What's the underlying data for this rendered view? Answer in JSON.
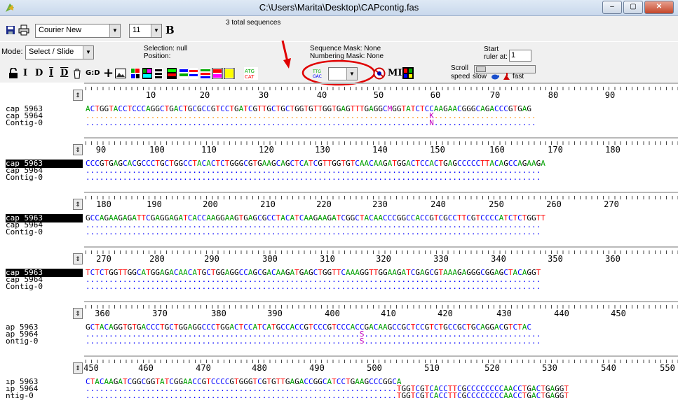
{
  "window": {
    "title": "C:\\Users\\Marita\\Desktop\\CAPcontig.fas",
    "minimize": "–",
    "maximize": "▢",
    "close": "✕"
  },
  "toolbar": {
    "font": "Courier New",
    "size": "11",
    "bold": "B",
    "total": "3 total sequences"
  },
  "mode": {
    "label": "Mode:",
    "value": "Select / Slide"
  },
  "selection": {
    "line1": "Selection: null",
    "line2": "Position:"
  },
  "masks": {
    "sequence": "Sequence Mask: None",
    "numbering": "Numbering Mask: None"
  },
  "start_ruler": {
    "label1": "Start",
    "label2": "ruler at:",
    "value": "1"
  },
  "scroll": {
    "label1": "Scroll",
    "label2": "speed",
    "slow": "slow",
    "fast": "fast"
  },
  "icons": [
    "I",
    "D",
    "I",
    "D",
    "G:D",
    "MI"
  ],
  "colors": {
    "A": "#00a000",
    "C": "#0000ff",
    "G": "#000000",
    "T": "#ff0000",
    "dot": "#ff8c00",
    "highlight": "#ff0000"
  },
  "blocks": [
    {
      "ruler": [
        "10",
        "20",
        "30",
        "40",
        "50",
        "60",
        "70",
        "80",
        "90"
      ],
      "names": [
        "cap 5963",
        "cap 5964",
        "Contig-0"
      ],
      "selected": -1,
      "rows": [
        "ACTGGTACCTCCCAGGCTGACTGCGCCGTCCTGATCGTTGCTGCTGGTGTTGGTGAGTTTGAGGCMGGTATCTCCAAGAACGGGCAGACCCGTGAG",
        "..........................................................................K......................",
        "..........................................................................N......................"
      ],
      "dot_colors": [
        "#ff8c00",
        "#0000ff"
      ]
    },
    {
      "ruler": [
        "90",
        "100",
        "110",
        "120",
        "130",
        "140",
        "150",
        "160",
        "170",
        "180"
      ],
      "names": [
        "cap 5963",
        "cap 5964",
        "Contig-0"
      ],
      "selected": 0,
      "rows": [
        "CCCGTGAGCACGCCCTGCTGGCCTACACTCTGGGCGTGAAGCAGCTCATCGTTGGTGTCAACAAGATGGACTCCACTGAGCCCCCTTACAGCCAGAAGA",
        "..................................................................................................",
        ".................................................................................................."
      ],
      "dot_colors": [
        "#0000ff",
        "#0000ff"
      ]
    },
    {
      "ruler": [
        "180",
        "190",
        "200",
        "210",
        "220",
        "230",
        "240",
        "250",
        "260",
        "270"
      ],
      "names": [
        "cap 5963",
        "cap 5964",
        "Contig-0"
      ],
      "selected": 0,
      "rows": [
        "GCCAGAAGAGATTCGAGGAGATCACCAAGGAAGTGAGCGCCTACATCAAGAAGATCGGCTACAACCCGGCCACCGTCGCCTTCGTCCCCATCTCTGGTT",
        "..................................................................................................",
        ".................................................................................................."
      ],
      "dot_colors": [
        "#0000ff",
        "#0000ff"
      ]
    },
    {
      "ruler": [
        "270",
        "280",
        "290",
        "300",
        "310",
        "320",
        "330",
        "340",
        "350",
        "360"
      ],
      "names": [
        "cap 5963",
        "cap 5964",
        "Contig-0"
      ],
      "selected": 0,
      "rows": [
        "TCTCTGGTTGGCATGGAGACAACATGCTGGAGGCCAGCGACAAGATGAGCTGGTTCAAAGGTTGGAAGATCGAGCGTAAAGAGGGCGGAGCTACAGGT",
        "..................................................................................................",
        ".................................................................................................."
      ],
      "dot_colors": [
        "#0000ff",
        "#0000ff"
      ]
    },
    {
      "ruler": [
        "360",
        "370",
        "380",
        "390",
        "400",
        "410",
        "420",
        "430",
        "440",
        "450"
      ],
      "names": [
        "ap 5963",
        "ap 5964",
        "ontig-0"
      ],
      "selected": -1,
      "rows": [
        "GCTACAGGTGTGACCCTGCTGGAGGCCCTGGACTCCATCATGCCACCGTCCCGTCCCACCGACAAGCCGCTCCGTCTGCCGCTGCAGGACGTCTAC",
        "...........................................................S......................................",
        "...........................................................S......................................"
      ],
      "dot_colors": [
        "#0000ff",
        "#0000ff"
      ]
    },
    {
      "ruler": [
        "450",
        "460",
        "470",
        "480",
        "490",
        "500",
        "510",
        "520",
        "530",
        "540",
        "550"
      ],
      "names": [
        "ıp 5963",
        "ıp 5964",
        "ntig-0"
      ],
      "selected": -1,
      "rows": [
        "CTACAAGATCGGCGGTATCGGAACCGTCCCCGTGGGTCGTGTTGAGACCGGCATCCTGAAGCCCGGCA",
        "...................................................................TGGTCGTCACCTTCGCCCCCCCCAACCTGACTGAGGT",
        "...................................................................TGGTCGTCACCTTCGCCCCCCCCAACCTGACTGAGGT"
      ],
      "dot_colors": [
        "#0000ff",
        "#0000ff"
      ]
    }
  ]
}
